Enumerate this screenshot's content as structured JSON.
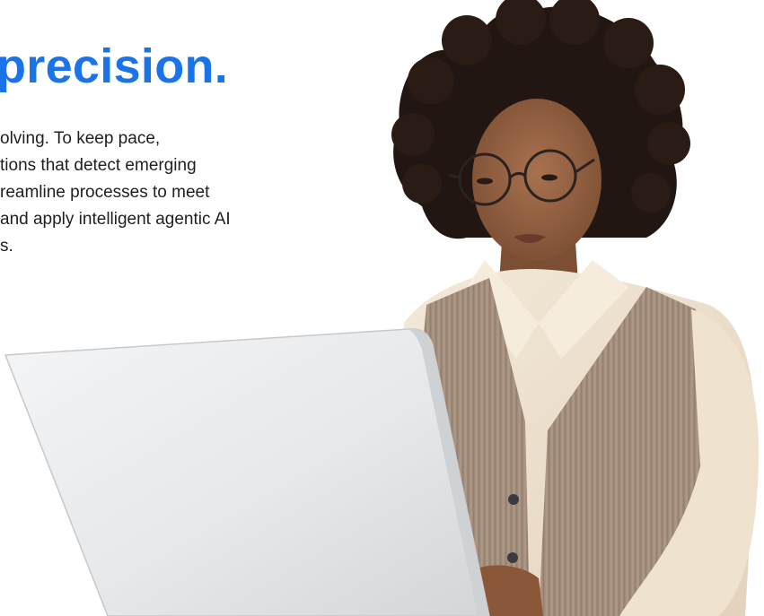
{
  "hero": {
    "headline": "precision.",
    "body_lines": [
      "olving. To keep pace,",
      "tions that detect emerging",
      "reamline processes to meet",
      "and apply intelligent agentic AI",
      "s."
    ],
    "accent_color": "#1a73e8"
  }
}
